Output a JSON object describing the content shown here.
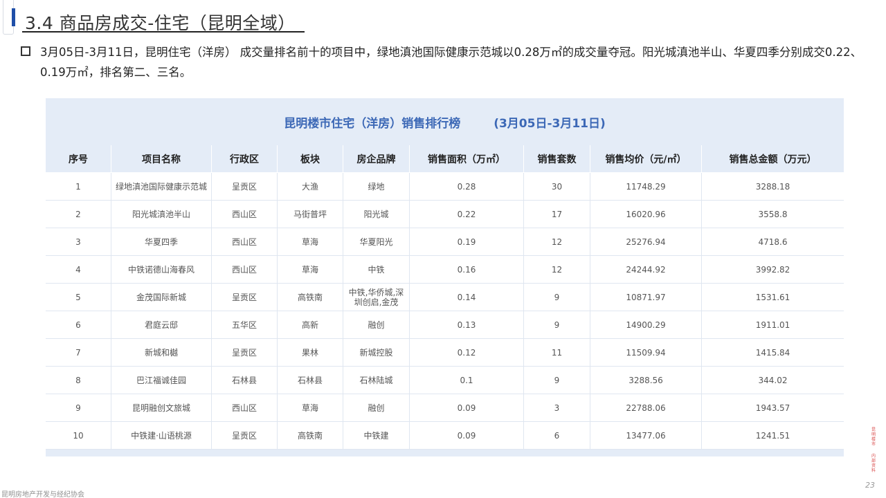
{
  "page": {
    "title": "3.4 商品房成交-住宅（昆明全域）",
    "summary": "3月05日-3月11日，昆明住宅（洋房） 成交量排名前十的项目中，绿地滇池国际健康示范城以0.28万㎡的成交量夺冠。阳光城滇池半山、华夏四季分别成交0.22、0.19万㎡，排名第二、三名。"
  },
  "table": {
    "title": "昆明楼市住宅（洋房）销售排行榜",
    "date_range": "(3月05日-3月11日)",
    "columns": [
      "序号",
      "项目名称",
      "行政区",
      "板块",
      "房企品牌",
      "销售面积（万㎡）",
      "销售套数",
      "销售均价（元/㎡）",
      "销售总金额（万元）"
    ],
    "rows": [
      [
        "1",
        "绿地滇池国际健康示范城",
        "呈贡区",
        "大渔",
        "绿地",
        "0.28",
        "30",
        "11748.29",
        "3288.18"
      ],
      [
        "2",
        "阳光城滇池半山",
        "西山区",
        "马街普坪",
        "阳光城",
        "0.22",
        "17",
        "16020.96",
        "3558.8"
      ],
      [
        "3",
        "华夏四季",
        "西山区",
        "草海",
        "华夏阳光",
        "0.19",
        "12",
        "25276.94",
        "4718.6"
      ],
      [
        "4",
        "中铁诺德山海春风",
        "西山区",
        "草海",
        "中铁",
        "0.16",
        "12",
        "24244.92",
        "3992.82"
      ],
      [
        "5",
        "金茂国际新城",
        "呈贡区",
        "高铁南",
        "中铁,华侨城,深圳创启,金茂",
        "0.14",
        "9",
        "10871.97",
        "1531.61"
      ],
      [
        "6",
        "君庭云邸",
        "五华区",
        "高新",
        "融创",
        "0.13",
        "9",
        "14900.29",
        "1911.01"
      ],
      [
        "7",
        "新城和樾",
        "呈贡区",
        "果林",
        "新城控股",
        "0.12",
        "11",
        "11509.94",
        "1415.84"
      ],
      [
        "8",
        "巴江福诚佳园",
        "石林县",
        "石林县",
        "石林陆城",
        "0.1",
        "9",
        "3288.56",
        "344.02"
      ],
      [
        "9",
        "昆明融创文旅城",
        "西山区",
        "草海",
        "融创",
        "0.09",
        "3",
        "22788.06",
        "1943.57"
      ],
      [
        "10",
        "中铁建·山语桃源",
        "呈贡区",
        "高铁南",
        "中铁建",
        "0.09",
        "6",
        "13477.06",
        "1241.51"
      ]
    ]
  },
  "footer": {
    "org": "昆明房地产开发与经纪协会",
    "page_number": "23",
    "side_tag_top": "昆明楼市",
    "side_tag_bottom": "内部资料"
  }
}
